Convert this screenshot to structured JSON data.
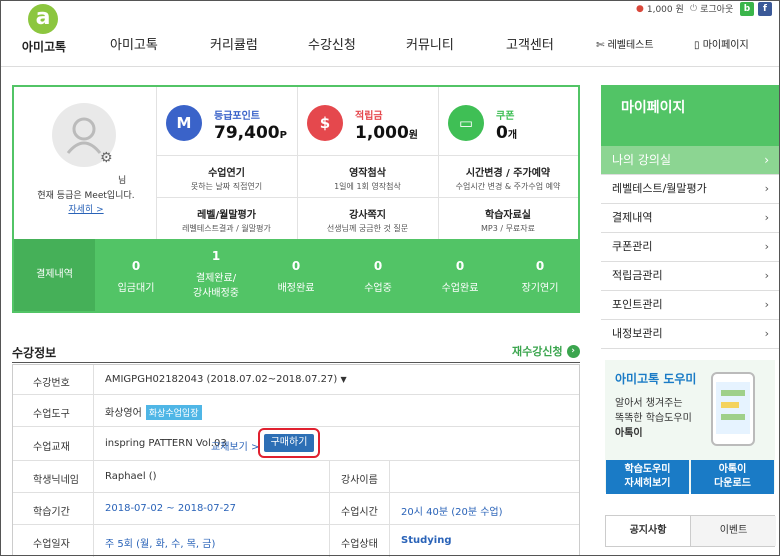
{
  "logo": {
    "mark": "a",
    "label": "아미고톡"
  },
  "topbar": {
    "points": "1,000 원",
    "login": "로그아웃",
    "icon_b": "b",
    "icon_f": "f"
  },
  "nav": [
    "아미고톡",
    "커리큘럼",
    "수강신청",
    "커뮤니티",
    "고객센터"
  ],
  "nav_right": {
    "level_test": "레벨테스트",
    "mypage": "마이페이지"
  },
  "profile": {
    "name_suffix": "님",
    "grade_text": "현재 등급은 Meet입니다.",
    "detail_link": "자세히 >"
  },
  "stats": [
    {
      "icon": "M",
      "label": "등급포인트",
      "value": "79,400",
      "unit": "P",
      "color": "#3a63c9"
    },
    {
      "icon": "$",
      "label": "적립금",
      "value": "1,000",
      "unit": "원",
      "color": "#e5484d"
    },
    {
      "icon": "▭",
      "label": "쿠폰",
      "value": "0",
      "unit": "개",
      "color": "#3fbf55"
    }
  ],
  "menu_cells": [
    {
      "title": "수업연기",
      "sub": "못하는 날짜 직접연기"
    },
    {
      "title": "영작첨삭",
      "sub": "1일에 1회 영작첨삭"
    },
    {
      "title": "시간변경 / 주가예약",
      "sub": "수업시간 변경 & 주가수업 예약"
    },
    {
      "title": "레벨/월말평가",
      "sub": "레벨테스트결과 / 월말평가"
    },
    {
      "title": "강사쪽지",
      "sub": "선생님께 궁금한 것 질문"
    },
    {
      "title": "학습자료실",
      "sub": "MP3 / 무료자료"
    }
  ],
  "payment": {
    "header": "결제내역",
    "items": [
      {
        "count": "0",
        "label": "입금대기"
      },
      {
        "count": "1",
        "label": "결제완료/\n강사배정중"
      },
      {
        "count": "0",
        "label": "배정완료"
      },
      {
        "count": "0",
        "label": "수업중"
      },
      {
        "count": "0",
        "label": "수업완료"
      },
      {
        "count": "0",
        "label": "장기연기"
      }
    ]
  },
  "course": {
    "title": "수강정보",
    "reapply": "재수강신청",
    "rows": {
      "number": {
        "label": "수강번호",
        "value": "AMIGPGH02182043 (2018.07.02~2018.07.27)"
      },
      "tool": {
        "label": "수업도구",
        "value": "화상영어",
        "tag": "화상수업입장"
      },
      "material": {
        "label": "수업교재",
        "value": "inspring PATTERN Vol.03",
        "view": "교재보기 >",
        "buy": "구매하기"
      },
      "student": {
        "label": "학생닉네임",
        "value": "Raphael ()",
        "label2": "강사이름",
        "value2": ""
      },
      "period": {
        "label": "학습기간",
        "value": "2018-07-02 ~ 2018-07-27",
        "label2": "수업시간",
        "value2": "20시 40분 (20분 수업)"
      },
      "days": {
        "label": "수업일자",
        "value": "주 5회 (월, 화, 수, 목, 금)",
        "label2": "수업상태",
        "value2": "Studying"
      }
    }
  },
  "sidebar": {
    "title": "마이페이지",
    "items": [
      "나의 강의실",
      "레벨테스트/월말평가",
      "결제내역",
      "쿠폰관리",
      "적립금관리",
      "포인트관리",
      "내정보관리"
    ],
    "helper_title": "아미고톡 도우미",
    "helper_text": [
      "알아서 챙겨주는",
      "똑똑한 학습도우미",
      "아톡이"
    ],
    "btn1": [
      "학습도우미",
      "자세히보기"
    ],
    "btn2": [
      "아톡이",
      "다운로드"
    ],
    "tabs": [
      "공지사항",
      "이벤트"
    ]
  }
}
